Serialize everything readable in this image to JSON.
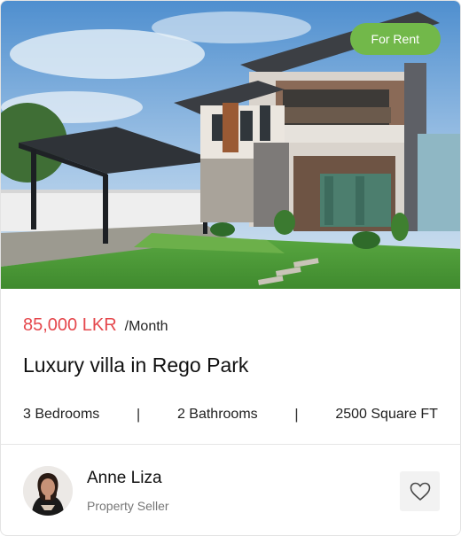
{
  "listing": {
    "badge": "For Rent",
    "price": "85,000 LKR",
    "period": "/Month",
    "title": "Luxury villa in Rego Park",
    "features": [
      "3 Bedrooms",
      "2 Bathrooms",
      "2500 Square FT"
    ],
    "separator": "|"
  },
  "seller": {
    "name": "Anne Liza",
    "role": "Property Seller"
  },
  "colors": {
    "badge": "#72b84a",
    "price": "#e5484d"
  },
  "icons": {
    "favorite": "heart-icon"
  }
}
